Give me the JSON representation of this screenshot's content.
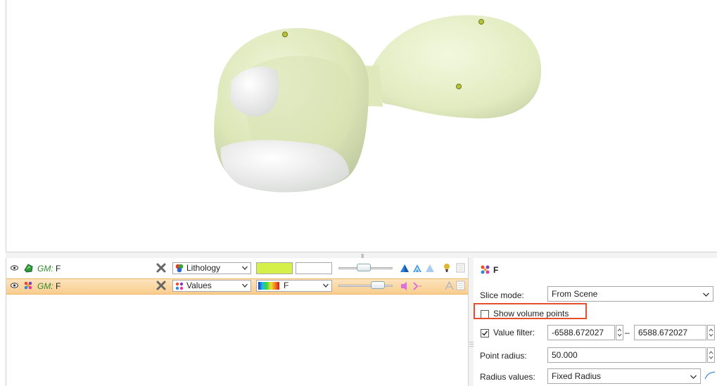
{
  "layers": [
    {
      "prefix": "GM:",
      "name": "F",
      "display_mode": "Lithology",
      "display_icon": "lithology-icon",
      "color": "#d6f04a",
      "color2": "#ffffff",
      "selected": false,
      "opacity": 0.45
    },
    {
      "prefix": "GM:",
      "name": "F",
      "display_mode": "Values",
      "display_icon": "values-icon",
      "colormap_label": "F",
      "selected": true,
      "opacity": 0.8
    }
  ],
  "properties": {
    "title": "F",
    "slice_mode": {
      "label": "Slice mode:",
      "value": "From Scene"
    },
    "show_volume_points": {
      "label": "Show volume points",
      "checked": false
    },
    "value_filter": {
      "label": "Value filter:",
      "checked": true,
      "min": "-6588.672027",
      "max": "6588.672027",
      "separator": "–"
    },
    "point_radius": {
      "label": "Point radius:",
      "value": "50.000"
    },
    "radius_values": {
      "label": "Radius values:",
      "value": "Fixed Radius"
    }
  },
  "colors": {
    "selection_bg": "#f8cd8e",
    "highlight_border": "#e5502a",
    "surface": "#e4ecc7"
  }
}
